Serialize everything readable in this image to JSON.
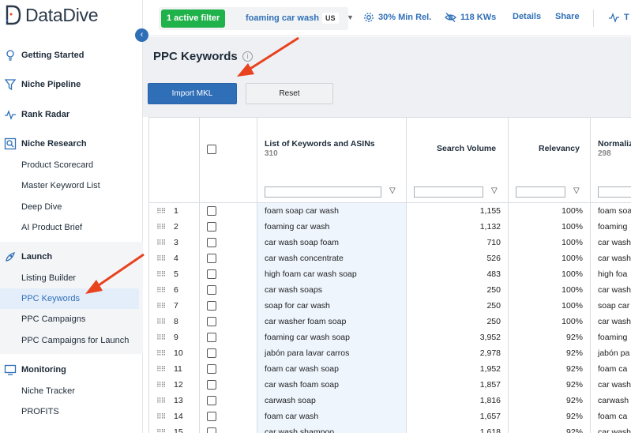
{
  "brand": {
    "logo_text": "DataDive"
  },
  "sidebar": {
    "sections": [
      {
        "label": "Getting Started",
        "icon": "lightbulb-icon"
      },
      {
        "label": "Niche Pipeline",
        "icon": "funnel-icon"
      },
      {
        "label": "Rank Radar",
        "icon": "pulse-icon"
      },
      {
        "label": "Niche Research",
        "icon": "research-icon"
      },
      {
        "label": "Launch",
        "icon": "rocket-icon"
      },
      {
        "label": "Monitoring",
        "icon": "monitor-icon"
      }
    ],
    "research_items": [
      "Product Scorecard",
      "Master Keyword List",
      "Deep Dive",
      "AI Product Brief"
    ],
    "launch_items": [
      "Listing Builder",
      "PPC Keywords",
      "PPC Campaigns",
      "PPC Campaigns for Launch"
    ],
    "monitoring_items": [
      "Niche Tracker",
      "PROFITS"
    ],
    "active_item": "PPC Keywords"
  },
  "topbar": {
    "filter_badge": "1 active filter",
    "filter_text": "foaming car wash",
    "marketplace": "US",
    "min_rel": "30% Min Rel.",
    "kws": "118 KWs",
    "details": "Details",
    "share": "Share",
    "extra": "T"
  },
  "page": {
    "title": "PPC Keywords",
    "info_icon": "info-icon"
  },
  "toolbar": {
    "import_label": "Import MKL",
    "reset_label": "Reset"
  },
  "table": {
    "columns": {
      "keywords": {
        "label": "List of Keywords and ASINs",
        "count": "310"
      },
      "search_volume": {
        "label": "Search Volume"
      },
      "relevancy": {
        "label": "Relevancy"
      },
      "normalized": {
        "label": "Normaliz",
        "count": "298"
      }
    },
    "rows": [
      {
        "n": "1",
        "kw": "foam soap car wash",
        "sv": "1,155",
        "rel": "100%",
        "norm": "foam soa"
      },
      {
        "n": "2",
        "kw": "foaming car wash",
        "sv": "1,132",
        "rel": "100%",
        "norm": "foaming"
      },
      {
        "n": "3",
        "kw": "car wash soap foam",
        "sv": "710",
        "rel": "100%",
        "norm": "car wash"
      },
      {
        "n": "4",
        "kw": "car wash concentrate",
        "sv": "526",
        "rel": "100%",
        "norm": "car wash"
      },
      {
        "n": "5",
        "kw": "high foam car wash soap",
        "sv": "483",
        "rel": "100%",
        "norm": "high foa"
      },
      {
        "n": "6",
        "kw": "car wash soaps",
        "sv": "250",
        "rel": "100%",
        "norm": "car wash"
      },
      {
        "n": "7",
        "kw": "soap for car wash",
        "sv": "250",
        "rel": "100%",
        "norm": "soap car"
      },
      {
        "n": "8",
        "kw": "car washer foam soap",
        "sv": "250",
        "rel": "100%",
        "norm": "car wash"
      },
      {
        "n": "9",
        "kw": "foaming car wash soap",
        "sv": "3,952",
        "rel": "92%",
        "norm": "foaming"
      },
      {
        "n": "10",
        "kw": "jabón para lavar carros",
        "sv": "2,978",
        "rel": "92%",
        "norm": "jabón pa"
      },
      {
        "n": "11",
        "kw": "foam car wash soap",
        "sv": "1,952",
        "rel": "92%",
        "norm": "foam ca"
      },
      {
        "n": "12",
        "kw": "car wash foam soap",
        "sv": "1,857",
        "rel": "92%",
        "norm": "car wash"
      },
      {
        "n": "13",
        "kw": "carwash soap",
        "sv": "1,816",
        "rel": "92%",
        "norm": "carwash"
      },
      {
        "n": "14",
        "kw": "foam car wash",
        "sv": "1,657",
        "rel": "92%",
        "norm": "foam ca"
      },
      {
        "n": "15",
        "kw": "car wash shampoo",
        "sv": "1,618",
        "rel": "92%",
        "norm": "car wash"
      }
    ],
    "highlighted_row": "11"
  },
  "colors": {
    "accent": "#2f6fb7",
    "filter_green": "#1fb14a",
    "annotation_arrow": "#e8421f"
  }
}
